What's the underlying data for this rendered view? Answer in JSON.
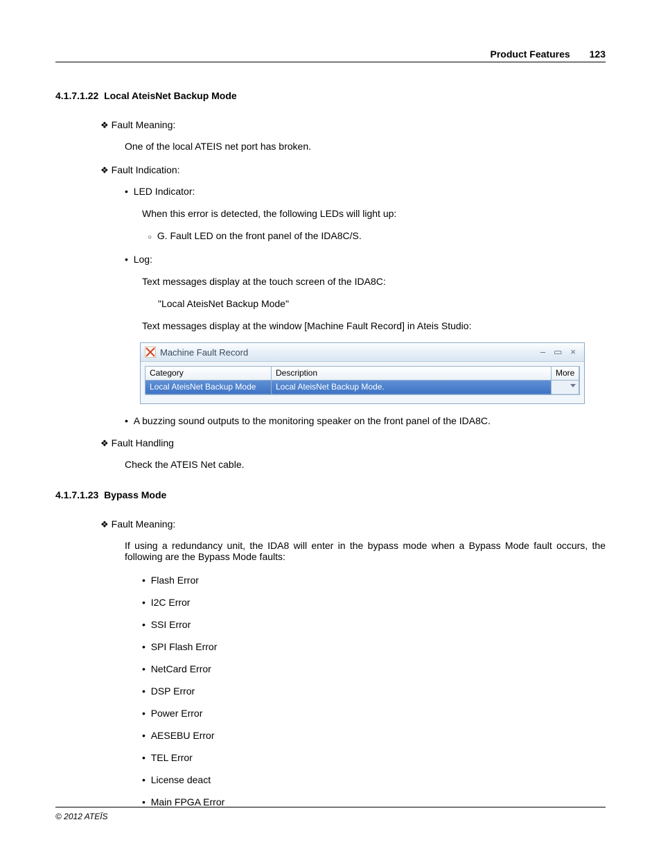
{
  "header": {
    "title": "Product Features",
    "page": "123"
  },
  "s22": {
    "num": "4.1.7.1.22",
    "title": "Local AteisNet Backup Mode",
    "fm_label": "Fault Meaning:",
    "fm_body": "One of the local ATEIS net port has broken.",
    "fi_label": "Fault Indication:",
    "led_label": "LED Indicator:",
    "led_body1": "When this error is detected, the following LEDs will light up:",
    "led_body2": "G. Fault LED on the front panel of the IDA8C/S.",
    "log_label": "Log:",
    "log_body1": "Text messages display at the touch screen of the IDA8C:",
    "log_msg": "\"Local AteisNet Backup Mode\"",
    "log_body2": "Text messages display at the window [Machine Fault Record] in Ateis Studio:",
    "buzz": "A buzzing sound outputs to the monitoring speaker on the front panel of the IDA8C.",
    "fh_label": "Fault Handling",
    "fh_body": "Check the ATEIS Net cable."
  },
  "mfr": {
    "window_title": "Machine Fault Record",
    "min": "–",
    "max": "▭",
    "close": "×",
    "cols": {
      "category": "Category",
      "description": "Description",
      "more": "More"
    },
    "row": {
      "category": "Local AteisNet Backup Mode",
      "description": "Local AteisNet Backup Mode."
    }
  },
  "s23": {
    "num": "4.1.7.1.23",
    "title": "Bypass Mode",
    "fm_label": "Fault Meaning:",
    "fm_body": "If using a redundancy unit, the IDA8 will enter in the bypass mode when a Bypass Mode fault occurs, the following are the Bypass Mode faults:",
    "faults": [
      "Flash Error",
      "I2C Error",
      "SSI Error",
      "SPI Flash Error",
      "NetCard Error",
      "DSP Error",
      "Power Error",
      "AESEBU Error",
      "TEL  Error",
      "License deact",
      "Main FPGA Error"
    ]
  },
  "footer": "© 2012 ATEÏS"
}
